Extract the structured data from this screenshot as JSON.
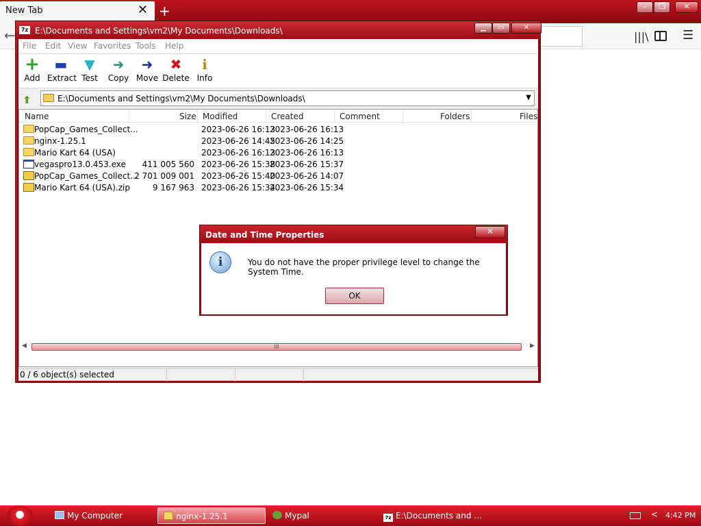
{
  "browser": {
    "tab_title": "New Tab",
    "tab_close": "✕",
    "new_tab": "+",
    "back": "⟵",
    "library_icon": "library-icon",
    "sidebar_icon": "sidebar-icon",
    "menu_icon": "☰"
  },
  "zip": {
    "title": "E:\\Documents and Settings\\vm2\\My Documents\\Downloads\\",
    "title_icon_text": "7z",
    "menu": [
      "File",
      "Edit",
      "View",
      "Favorites",
      "Tools",
      "Help"
    ],
    "toolbar": [
      {
        "label": "Add",
        "icon": "+",
        "color": "#2aa52a"
      },
      {
        "label": "Extract",
        "icon": "▬",
        "color": "#1e3fb0"
      },
      {
        "label": "Test",
        "icon": "▼",
        "color": "#2bb3c7"
      },
      {
        "label": "Copy",
        "icon": "➜",
        "color": "#2a8f7a"
      },
      {
        "label": "Move",
        "icon": "➜",
        "color": "#1b2a8f"
      },
      {
        "label": "Delete",
        "icon": "✖",
        "color": "#d1121b"
      },
      {
        "label": "Info",
        "icon": "i",
        "color": "#b08a10"
      }
    ],
    "address": "E:\\Documents and Settings\\vm2\\My Documents\\Downloads\\",
    "columns": [
      "Name",
      "Size",
      "Modified",
      "Created",
      "Comment",
      "Folders",
      "Files"
    ],
    "rows": [
      {
        "type": "folder",
        "name": "PopCap_Games_Collect...",
        "size": "",
        "modified": "2023-06-26 16:13",
        "created": "2023-06-26 16:13"
      },
      {
        "type": "folder",
        "name": "nginx-1.25.1",
        "size": "",
        "modified": "2023-06-26 14:45",
        "created": "2023-06-26 14:25"
      },
      {
        "type": "folder",
        "name": "Mario Kart 64 (USA)",
        "size": "",
        "modified": "2023-06-26 16:13",
        "created": "2023-06-26 16:13"
      },
      {
        "type": "exe",
        "name": "vegaspro13.0.453.exe",
        "size": "411 005 560",
        "modified": "2023-06-26 15:38",
        "created": "2023-06-26 15:37"
      },
      {
        "type": "zip",
        "name": "PopCap_Games_Collect...",
        "size": "2 701 009 001",
        "modified": "2023-06-26 15:40",
        "created": "2023-06-26 14:07"
      },
      {
        "type": "zip",
        "name": "Mario Kart 64 (USA).zip",
        "size": "9 167 963",
        "modified": "2023-06-26 15:34",
        "created": "2023-06-26 15:34"
      }
    ],
    "scroll_grip": "III",
    "status": "0 / 6 object(s) selected"
  },
  "dialog": {
    "title": "Date and Time Properties",
    "close": "✕",
    "info_icon": "i",
    "message": "You do not have the proper privilege level to change the System Time.",
    "ok": "OK"
  },
  "taskbar": {
    "items": [
      {
        "label": "My Computer",
        "icon": "computer-icon"
      },
      {
        "label": "nginx-1.25.1",
        "icon": "folder-icon"
      },
      {
        "label": "Mypal",
        "icon": "mypal-icon"
      },
      {
        "label": "E:\\Documents and ...",
        "icon": "7zip-icon"
      }
    ],
    "tray_chevron": "<",
    "clock": "4:42 PM"
  },
  "colors": {
    "accent": "#8d0d13",
    "titlebar": "#c8242c",
    "taskbar": "#d4202a"
  }
}
